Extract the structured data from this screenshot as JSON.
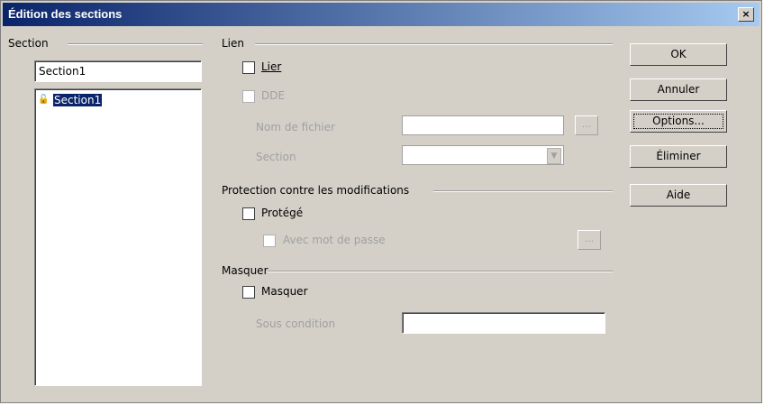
{
  "window": {
    "title": "Édition des sections",
    "close_label": "×"
  },
  "section_group": {
    "label": "Section",
    "name_value": "Section1",
    "tree_item": "Section1"
  },
  "lien": {
    "label": "Lien",
    "lier_label": "Lier",
    "dde_label": "DDE",
    "filename_label": "Nom de fichier",
    "filename_value": "",
    "section_label": "Section",
    "section_value": "",
    "browse_label": "..."
  },
  "protection": {
    "label": "Protection contre les modifications",
    "protege_label": "Protégé",
    "password_label": "Avec mot de passe",
    "password_btn_label": "..."
  },
  "masquer": {
    "label": "Masquer",
    "masquer_label": "Masquer",
    "condition_label": "Sous condition",
    "condition_value": ""
  },
  "buttons": {
    "ok": "OK",
    "annuler": "Annuler",
    "options": "Options...",
    "eliminer": "Éliminer",
    "aide": "Aide"
  }
}
